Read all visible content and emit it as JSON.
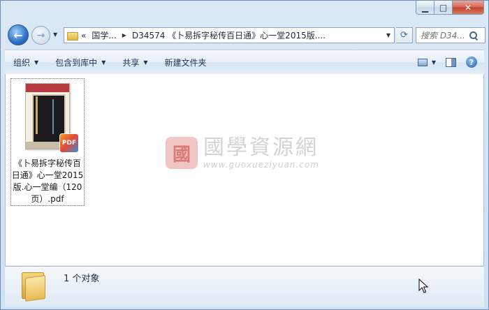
{
  "window": {
    "minimize_glyph": "▁",
    "maximize_glyph": "□",
    "close_glyph": "✕"
  },
  "navigation": {
    "back_glyph": "←",
    "forward_glyph": "→",
    "history_glyph": "▼"
  },
  "address": {
    "overflow": "«",
    "segment_1": "国学...",
    "segment_2": "D34574 《卜易拆字秘传百日通》心一堂2015版....",
    "dropdown_glyph": "▼",
    "refresh_glyph": "⟳"
  },
  "search": {
    "placeholder": "搜索 D34..."
  },
  "toolbar": {
    "organize": "组织",
    "include_in_library": "包含到库中",
    "share": "共享",
    "new_folder": "新建文件夹",
    "help_glyph": "?"
  },
  "files": [
    {
      "name": "《卜易拆字秘传百日通》心一堂2015版.心一堂编（120页）.pdf",
      "badge": "PDF"
    }
  ],
  "watermark": {
    "logo_glyph": "國",
    "title": "國學資源網",
    "url": "www.guoxueziyuan.com"
  },
  "details": {
    "count_text": "1 个对象"
  },
  "colors": {
    "frame": "#dbe8f5",
    "close_button": "#c2412c",
    "toolbar_text": "#1e3454",
    "folder_yellow": "#eab950"
  }
}
